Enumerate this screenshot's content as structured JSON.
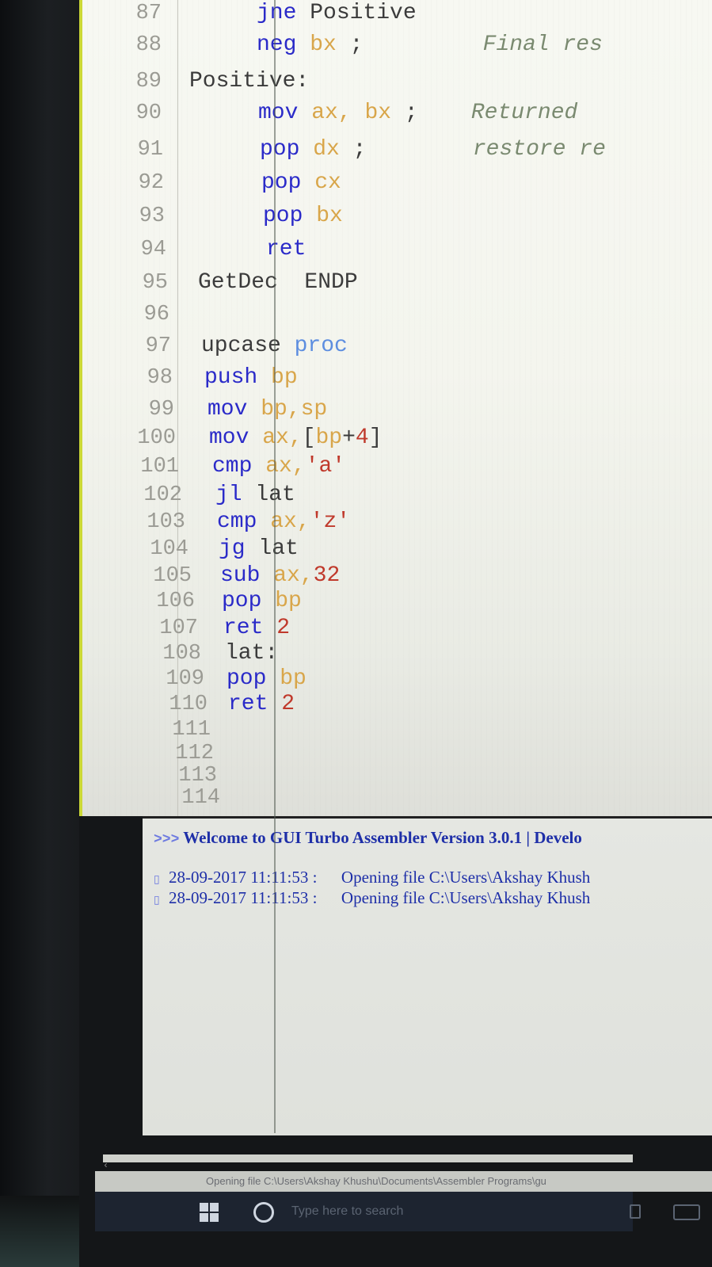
{
  "editor": {
    "lines": [
      {
        "num": "87",
        "indent": "    ",
        "tokens": [
          [
            "kw",
            "jne"
          ],
          [
            "lbl",
            " Positive"
          ]
        ]
      },
      {
        "num": "88",
        "indent": "    ",
        "tokens": [
          [
            "kw",
            "neg"
          ],
          [
            "reg",
            " bx"
          ],
          [
            "sym",
            " ;"
          ],
          [
            "cmt",
            "         Final res"
          ]
        ]
      },
      {
        "num": "89",
        "indent": "",
        "tokens": [
          [
            "lbl",
            "Positive:"
          ]
        ]
      },
      {
        "num": "90",
        "indent": "    ",
        "tokens": [
          [
            "kw",
            "mov"
          ],
          [
            "reg",
            " ax,"
          ],
          [
            "reg",
            " bx"
          ],
          [
            "sym",
            " ;"
          ],
          [
            "cmt",
            "    Returned"
          ]
        ]
      },
      {
        "num": "91",
        "indent": "    ",
        "tokens": [
          [
            "kw",
            "pop"
          ],
          [
            "reg",
            " dx"
          ],
          [
            "sym",
            " ;"
          ],
          [
            "cmt",
            "        restore re"
          ]
        ]
      },
      {
        "num": "92",
        "indent": "    ",
        "tokens": [
          [
            "kw",
            "pop"
          ],
          [
            "reg",
            " cx"
          ]
        ]
      },
      {
        "num": "93",
        "indent": "    ",
        "tokens": [
          [
            "kw",
            "pop"
          ],
          [
            "reg",
            " bx"
          ]
        ]
      },
      {
        "num": "94",
        "indent": "    ",
        "tokens": [
          [
            "kw",
            "ret"
          ]
        ]
      },
      {
        "num": "95",
        "indent": "",
        "tokens": [
          [
            "lbl",
            "GetDec  ENDP"
          ]
        ]
      },
      {
        "num": "96",
        "indent": "",
        "tokens": []
      },
      {
        "num": "97",
        "indent": "",
        "tokens": [
          [
            "lbl",
            "upcase "
          ],
          [
            "proc",
            "proc"
          ]
        ]
      },
      {
        "num": "98",
        "indent": "",
        "tokens": [
          [
            "kw",
            "push"
          ],
          [
            "reg",
            " bp"
          ]
        ]
      },
      {
        "num": "99",
        "indent": "",
        "tokens": [
          [
            "kw",
            "mov"
          ],
          [
            "reg",
            " bp,sp"
          ]
        ]
      },
      {
        "num": "100",
        "indent": "",
        "tokens": [
          [
            "kw",
            "mov"
          ],
          [
            "reg",
            " ax,"
          ],
          [
            "sym",
            "["
          ],
          [
            "reg",
            "bp"
          ],
          [
            "sym",
            "+"
          ],
          [
            "num",
            "4"
          ],
          [
            "sym",
            "]"
          ]
        ]
      },
      {
        "num": "101",
        "indent": "",
        "tokens": [
          [
            "kw",
            "cmp"
          ],
          [
            "reg",
            " ax,"
          ],
          [
            "str",
            "'a'"
          ]
        ]
      },
      {
        "num": "102",
        "indent": "",
        "tokens": [
          [
            "kw",
            "jl"
          ],
          [
            "lbl",
            " lat"
          ]
        ]
      },
      {
        "num": "103",
        "indent": "",
        "tokens": [
          [
            "kw",
            "cmp"
          ],
          [
            "reg",
            " ax,"
          ],
          [
            "str",
            "'z'"
          ]
        ]
      },
      {
        "num": "104",
        "indent": "",
        "tokens": [
          [
            "kw",
            "jg"
          ],
          [
            "lbl",
            " lat"
          ]
        ]
      },
      {
        "num": "105",
        "indent": "",
        "tokens": [
          [
            "kw",
            "sub"
          ],
          [
            "reg",
            " ax,"
          ],
          [
            "num",
            "32"
          ]
        ]
      },
      {
        "num": "106",
        "indent": "",
        "tokens": [
          [
            "kw",
            "pop"
          ],
          [
            "reg",
            " bp"
          ]
        ]
      },
      {
        "num": "107",
        "indent": "",
        "tokens": [
          [
            "kw",
            "ret"
          ],
          [
            "num",
            " 2"
          ]
        ]
      },
      {
        "num": "108",
        "indent": "",
        "tokens": [
          [
            "lbl",
            "lat:"
          ]
        ]
      },
      {
        "num": "109",
        "indent": "",
        "tokens": [
          [
            "kw",
            "pop"
          ],
          [
            "reg",
            " bp"
          ]
        ]
      },
      {
        "num": "110",
        "indent": "",
        "tokens": [
          [
            "kw",
            "ret"
          ],
          [
            "num",
            " 2"
          ]
        ]
      },
      {
        "num": "111",
        "indent": "",
        "tokens": []
      },
      {
        "num": "112",
        "indent": "",
        "tokens": []
      },
      {
        "num": "113",
        "indent": "",
        "tokens": []
      },
      {
        "num": "114",
        "indent": "",
        "tokens": []
      }
    ]
  },
  "console": {
    "prompt": ">>>",
    "welcome": "Welcome to GUI Turbo Assembler Version 3.0.1 | Develo",
    "log": [
      {
        "date": "28-09-2017 11:11:53 :",
        "message": "Opening file  C:\\Users\\Akshay Khush"
      },
      {
        "date": "28-09-2017 11:11:53 :",
        "message": "Opening file  C:\\Users\\Akshay Khush"
      }
    ]
  },
  "statusbar": {
    "text": "Opening file  C:\\Users\\Akshay Khushu\\Documents\\Assembler Programs\\gu"
  },
  "taskbar": {
    "search_placeholder": "Type here to search"
  },
  "colors": {
    "keyword": "#2a2ac9",
    "register": "#d9a64a",
    "string_number": "#c0392b",
    "comment": "#7a8a70",
    "console_text": "#1e2fa8",
    "gutter_accent": "#cbd836"
  }
}
